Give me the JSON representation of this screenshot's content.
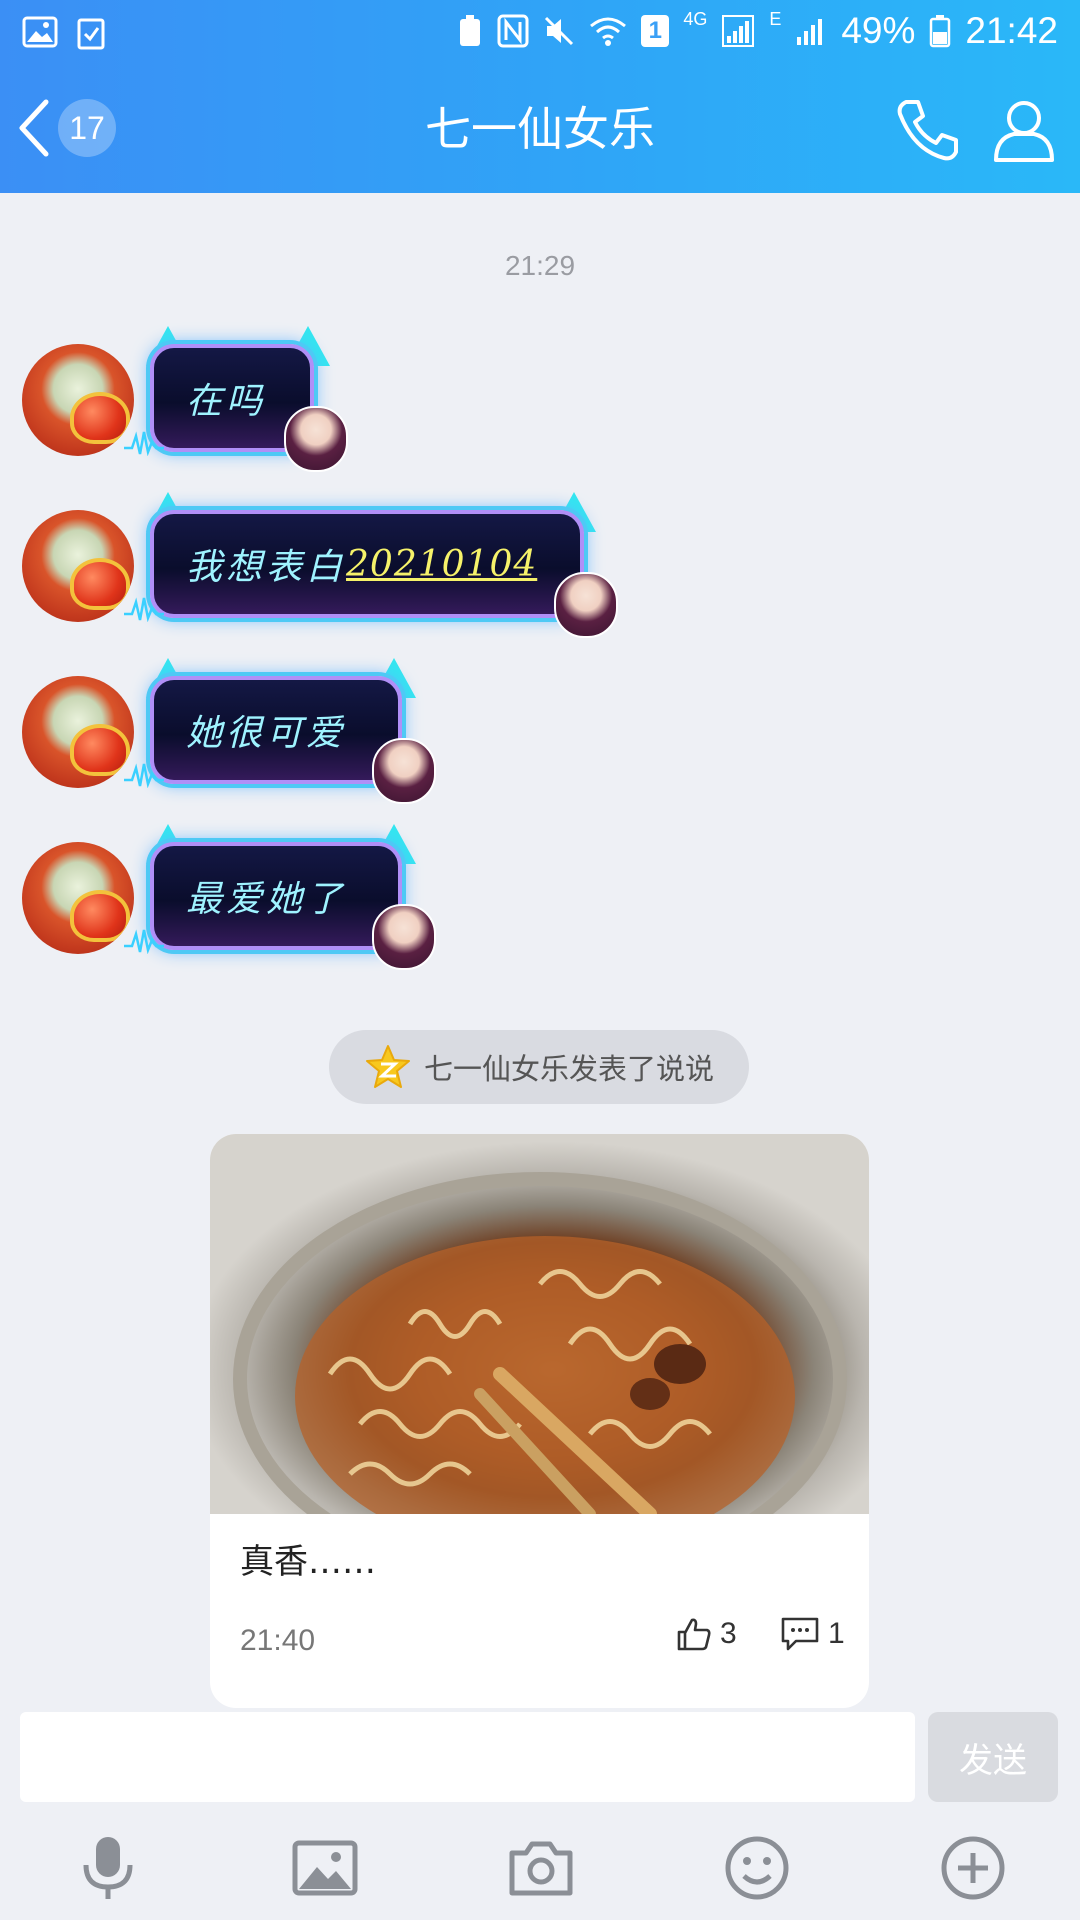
{
  "status_bar": {
    "battery": "49%",
    "time": "21:42",
    "network": "4G",
    "network2": "E",
    "sim": "1"
  },
  "header": {
    "unread_count": "17",
    "title": "七一仙女乐"
  },
  "messages": {
    "timestamp": "21:29",
    "m1": "在吗",
    "m2_text": "我想表白",
    "m2_link": "20210104",
    "m3": "她很可爱",
    "m4": "最爱她了"
  },
  "moment": {
    "notice": "七一仙女乐发表了说说",
    "caption": "真香……",
    "time": "21:40",
    "likes": "3",
    "comments": "1"
  },
  "input": {
    "placeholder": "",
    "send_label": "发送"
  },
  "colors": {
    "header_gradient_start": "#3b8ff5",
    "header_gradient_end": "#2ab8f8",
    "background": "#eef0f5",
    "bubble_text": "#9ff3ff",
    "link_text": "#f6f26a"
  },
  "toolbar": {
    "icons": [
      "microphone-icon",
      "image-icon",
      "camera-icon",
      "emoji-icon",
      "plus-icon"
    ]
  }
}
